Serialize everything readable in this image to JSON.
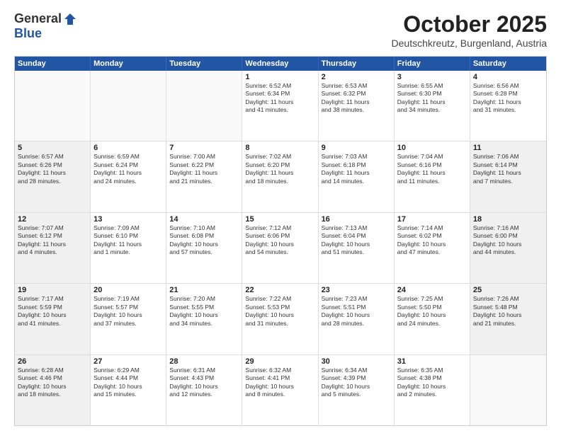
{
  "header": {
    "logo_general": "General",
    "logo_blue": "Blue",
    "month": "October 2025",
    "location": "Deutschkreutz, Burgenland, Austria"
  },
  "days_of_week": [
    "Sunday",
    "Monday",
    "Tuesday",
    "Wednesday",
    "Thursday",
    "Friday",
    "Saturday"
  ],
  "weeks": [
    [
      {
        "day": "",
        "empty": true
      },
      {
        "day": "",
        "empty": true
      },
      {
        "day": "",
        "empty": true
      },
      {
        "day": "1",
        "lines": [
          "Sunrise: 6:52 AM",
          "Sunset: 6:34 PM",
          "Daylight: 11 hours",
          "and 41 minutes."
        ]
      },
      {
        "day": "2",
        "lines": [
          "Sunrise: 6:53 AM",
          "Sunset: 6:32 PM",
          "Daylight: 11 hours",
          "and 38 minutes."
        ]
      },
      {
        "day": "3",
        "lines": [
          "Sunrise: 6:55 AM",
          "Sunset: 6:30 PM",
          "Daylight: 11 hours",
          "and 34 minutes."
        ]
      },
      {
        "day": "4",
        "lines": [
          "Sunrise: 6:56 AM",
          "Sunset: 6:28 PM",
          "Daylight: 11 hours",
          "and 31 minutes."
        ]
      }
    ],
    [
      {
        "day": "5",
        "shaded": true,
        "lines": [
          "Sunrise: 6:57 AM",
          "Sunset: 6:26 PM",
          "Daylight: 11 hours",
          "and 28 minutes."
        ]
      },
      {
        "day": "6",
        "lines": [
          "Sunrise: 6:59 AM",
          "Sunset: 6:24 PM",
          "Daylight: 11 hours",
          "and 24 minutes."
        ]
      },
      {
        "day": "7",
        "lines": [
          "Sunrise: 7:00 AM",
          "Sunset: 6:22 PM",
          "Daylight: 11 hours",
          "and 21 minutes."
        ]
      },
      {
        "day": "8",
        "lines": [
          "Sunrise: 7:02 AM",
          "Sunset: 6:20 PM",
          "Daylight: 11 hours",
          "and 18 minutes."
        ]
      },
      {
        "day": "9",
        "lines": [
          "Sunrise: 7:03 AM",
          "Sunset: 6:18 PM",
          "Daylight: 11 hours",
          "and 14 minutes."
        ]
      },
      {
        "day": "10",
        "lines": [
          "Sunrise: 7:04 AM",
          "Sunset: 6:16 PM",
          "Daylight: 11 hours",
          "and 11 minutes."
        ]
      },
      {
        "day": "11",
        "shaded": true,
        "lines": [
          "Sunrise: 7:06 AM",
          "Sunset: 6:14 PM",
          "Daylight: 11 hours",
          "and 7 minutes."
        ]
      }
    ],
    [
      {
        "day": "12",
        "shaded": true,
        "lines": [
          "Sunrise: 7:07 AM",
          "Sunset: 6:12 PM",
          "Daylight: 11 hours",
          "and 4 minutes."
        ]
      },
      {
        "day": "13",
        "lines": [
          "Sunrise: 7:09 AM",
          "Sunset: 6:10 PM",
          "Daylight: 11 hours",
          "and 1 minute."
        ]
      },
      {
        "day": "14",
        "lines": [
          "Sunrise: 7:10 AM",
          "Sunset: 6:08 PM",
          "Daylight: 10 hours",
          "and 57 minutes."
        ]
      },
      {
        "day": "15",
        "lines": [
          "Sunrise: 7:12 AM",
          "Sunset: 6:06 PM",
          "Daylight: 10 hours",
          "and 54 minutes."
        ]
      },
      {
        "day": "16",
        "lines": [
          "Sunrise: 7:13 AM",
          "Sunset: 6:04 PM",
          "Daylight: 10 hours",
          "and 51 minutes."
        ]
      },
      {
        "day": "17",
        "lines": [
          "Sunrise: 7:14 AM",
          "Sunset: 6:02 PM",
          "Daylight: 10 hours",
          "and 47 minutes."
        ]
      },
      {
        "day": "18",
        "shaded": true,
        "lines": [
          "Sunrise: 7:16 AM",
          "Sunset: 6:00 PM",
          "Daylight: 10 hours",
          "and 44 minutes."
        ]
      }
    ],
    [
      {
        "day": "19",
        "shaded": true,
        "lines": [
          "Sunrise: 7:17 AM",
          "Sunset: 5:59 PM",
          "Daylight: 10 hours",
          "and 41 minutes."
        ]
      },
      {
        "day": "20",
        "lines": [
          "Sunrise: 7:19 AM",
          "Sunset: 5:57 PM",
          "Daylight: 10 hours",
          "and 37 minutes."
        ]
      },
      {
        "day": "21",
        "lines": [
          "Sunrise: 7:20 AM",
          "Sunset: 5:55 PM",
          "Daylight: 10 hours",
          "and 34 minutes."
        ]
      },
      {
        "day": "22",
        "lines": [
          "Sunrise: 7:22 AM",
          "Sunset: 5:53 PM",
          "Daylight: 10 hours",
          "and 31 minutes."
        ]
      },
      {
        "day": "23",
        "lines": [
          "Sunrise: 7:23 AM",
          "Sunset: 5:51 PM",
          "Daylight: 10 hours",
          "and 28 minutes."
        ]
      },
      {
        "day": "24",
        "lines": [
          "Sunrise: 7:25 AM",
          "Sunset: 5:50 PM",
          "Daylight: 10 hours",
          "and 24 minutes."
        ]
      },
      {
        "day": "25",
        "shaded": true,
        "lines": [
          "Sunrise: 7:26 AM",
          "Sunset: 5:48 PM",
          "Daylight: 10 hours",
          "and 21 minutes."
        ]
      }
    ],
    [
      {
        "day": "26",
        "shaded": true,
        "lines": [
          "Sunrise: 6:28 AM",
          "Sunset: 4:46 PM",
          "Daylight: 10 hours",
          "and 18 minutes."
        ]
      },
      {
        "day": "27",
        "lines": [
          "Sunrise: 6:29 AM",
          "Sunset: 4:44 PM",
          "Daylight: 10 hours",
          "and 15 minutes."
        ]
      },
      {
        "day": "28",
        "lines": [
          "Sunrise: 6:31 AM",
          "Sunset: 4:43 PM",
          "Daylight: 10 hours",
          "and 12 minutes."
        ]
      },
      {
        "day": "29",
        "lines": [
          "Sunrise: 6:32 AM",
          "Sunset: 4:41 PM",
          "Daylight: 10 hours",
          "and 8 minutes."
        ]
      },
      {
        "day": "30",
        "lines": [
          "Sunrise: 6:34 AM",
          "Sunset: 4:39 PM",
          "Daylight: 10 hours",
          "and 5 minutes."
        ]
      },
      {
        "day": "31",
        "lines": [
          "Sunrise: 6:35 AM",
          "Sunset: 4:38 PM",
          "Daylight: 10 hours",
          "and 2 minutes."
        ]
      },
      {
        "day": "",
        "empty": true
      }
    ]
  ]
}
